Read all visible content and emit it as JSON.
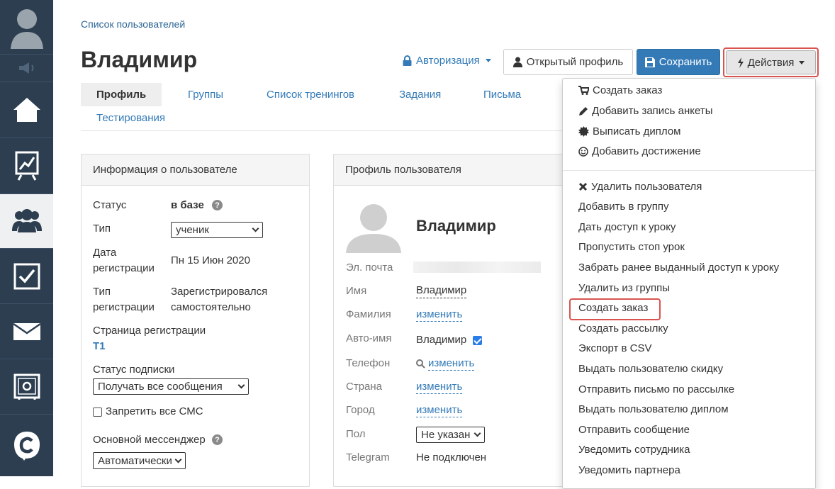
{
  "sidebar": {
    "items": [
      "avatar-icon",
      "speaker-icon",
      "home-icon",
      "chart-icon",
      "users-icon",
      "tasks-icon",
      "mail-icon",
      "safe-icon",
      "logo-icon"
    ],
    "active": "users-icon",
    "bg_color": "#2c3e50"
  },
  "breadcrumb": "Список пользователей",
  "title": "Владимир",
  "header": {
    "auth_label": "Авторизация",
    "profile_button": "Открытый профиль",
    "save_button": "Сохранить",
    "actions_button": "Действия"
  },
  "tabs": [
    "Профиль",
    "Группы",
    "Список тренингов",
    "Задания",
    "Письма",
    "Тестирования"
  ],
  "user_info": {
    "heading": "Информация о пользователе",
    "status_label": "Статус",
    "status_value": "в базе",
    "type_label": "Тип",
    "type_value": "ученик",
    "reg_date_label_1": "Дата",
    "reg_date_label_2": "регистрации",
    "reg_date_value": "Пн 15 Июн 2020",
    "reg_type_label_1": "Тип",
    "reg_type_label_2": "регистрации",
    "reg_type_value_1": "Зарегистрировался",
    "reg_type_value_2": "самостоятельно",
    "reg_page_label": "Страница регистрации",
    "reg_page_value": "Т1",
    "subscription_label": "Статус подписки",
    "subscription_value": "Получать все сообщения",
    "sms_label": "Запретить все СМС",
    "messenger_label": "Основной мессенджер",
    "messenger_value": "Автоматически"
  },
  "profile": {
    "heading": "Профиль пользователя",
    "name": "Владимир",
    "email_label": "Эл. почта",
    "first_name_label": "Имя",
    "first_name_value": "Владимир",
    "last_name_label": "Фамилия",
    "change_label": "изменить",
    "auto_name_label": "Авто-имя",
    "auto_name_value": "Владимир",
    "phone_label": "Телефон",
    "country_label": "Страна",
    "city_label": "Город",
    "gender_label": "Пол",
    "gender_value": "Не указан",
    "telegram_label": "Telegram",
    "telegram_value": "Не подключен"
  },
  "actions_menu": {
    "top_items": [
      {
        "icon": "cart-icon",
        "label": "Создать заказ"
      },
      {
        "icon": "pencil-icon",
        "label": "Добавить запись анкеты"
      },
      {
        "icon": "certificate-icon",
        "label": "Выписать диплом"
      },
      {
        "icon": "smile-icon",
        "label": "Добавить достижение"
      }
    ],
    "items": [
      "Удалить пользователя",
      "Добавить в группу",
      "Дать доступ к уроку",
      "Пропустить стоп урок",
      "Забрать ранее выданный доступ к уроку",
      "Удалить из группы",
      "Создать заказ",
      "Создать рассылку",
      "Экспорт в CSV",
      "Выдать пользователю скидку",
      "Отправить письмо по рассылке",
      "Выдать пользователю диплом",
      "Отправить сообщение",
      "Уведомить сотрудника",
      "Уведомить партнера"
    ]
  },
  "colors": {
    "primary": "#337ab7",
    "highlight": "#d9534f"
  }
}
